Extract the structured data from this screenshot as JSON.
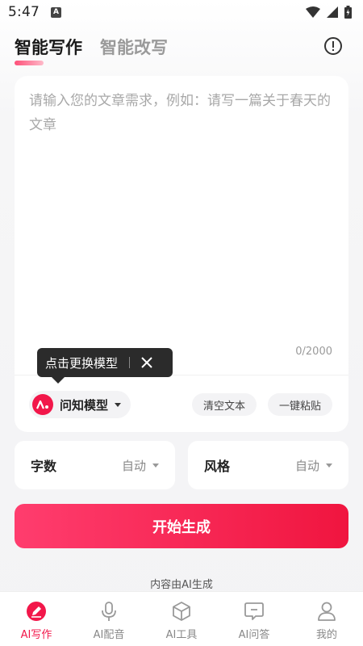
{
  "status_bar": {
    "time": "5:47",
    "notification_letter": "A"
  },
  "header": {
    "tabs": [
      {
        "label": "智能写作",
        "active": true
      },
      {
        "label": "智能改写",
        "active": false
      }
    ]
  },
  "editor": {
    "placeholder": "请输入您的文章需求，例如：请写一篇关于春天的文章",
    "value": "",
    "char_count": "0/2000"
  },
  "tooltip": {
    "text": "点击更换模型"
  },
  "toolbar": {
    "model_label": "问知模型",
    "clear_label": "清空文本",
    "paste_label": "一键粘贴"
  },
  "options": {
    "word_count": {
      "label": "字数",
      "value": "自动"
    },
    "style": {
      "label": "风格",
      "value": "自动"
    }
  },
  "generate": {
    "label": "开始生成"
  },
  "ai_note": "内容由AI生成",
  "nav": {
    "items": [
      {
        "label": "AI写作",
        "active": true,
        "icon": "pen-icon"
      },
      {
        "label": "AI配音",
        "active": false,
        "icon": "microphone-icon"
      },
      {
        "label": "AI工具",
        "active": false,
        "icon": "cube-icon"
      },
      {
        "label": "AI问答",
        "active": false,
        "icon": "chat-icon"
      },
      {
        "label": "我的",
        "active": false,
        "icon": "user-icon"
      }
    ]
  },
  "colors": {
    "accent": "#f2174a",
    "accent_light": "#ff3d6e",
    "tooltip_bg": "#2b2b2b"
  }
}
